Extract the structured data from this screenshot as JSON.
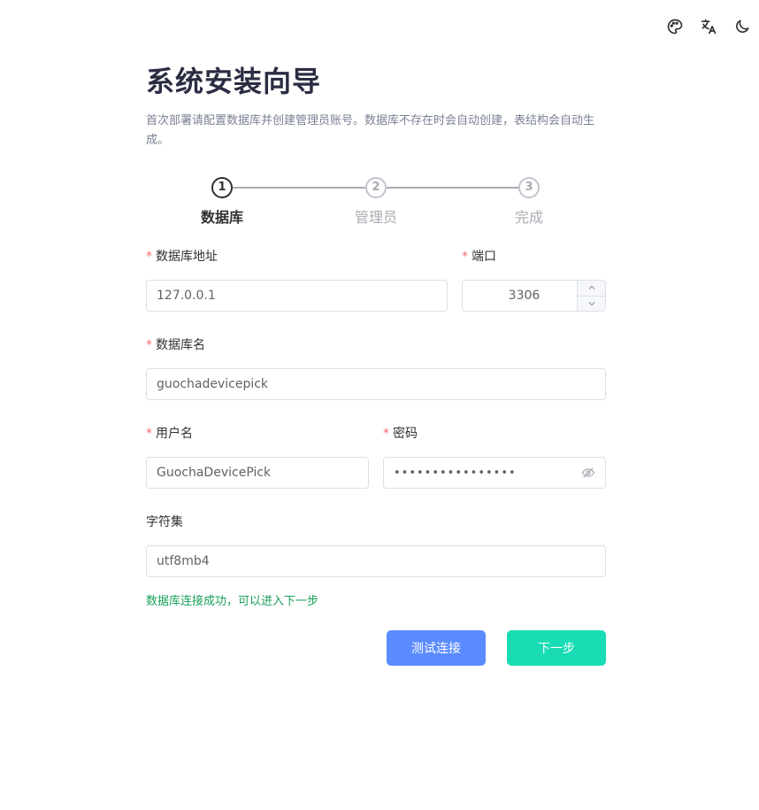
{
  "wizard": {
    "title": "系统安装向导",
    "description": "首次部署请配置数据库并创建管理员账号。数据库不存在时会自动创建，表结构会自动生成。"
  },
  "steps": [
    {
      "number": "1",
      "label": "数据库",
      "active": true
    },
    {
      "number": "2",
      "label": "管理员",
      "active": false
    },
    {
      "number": "3",
      "label": "完成",
      "active": false
    }
  ],
  "form": {
    "required_mark": "*",
    "host": {
      "label": "数据库地址",
      "value": "127.0.0.1"
    },
    "port": {
      "label": "端口",
      "value": "3306"
    },
    "db_name": {
      "label": "数据库名",
      "value": "guochadevicepick"
    },
    "username": {
      "label": "用户名",
      "value": "GuochaDevicePick"
    },
    "password": {
      "label": "密码",
      "value": "••••••••••••••••"
    },
    "charset": {
      "label": "字符集",
      "value": "utf8mb4"
    }
  },
  "status": {
    "message": "数据库连接成功，可以进入下一步",
    "color": "#18a058"
  },
  "buttons": {
    "test": "测试连接",
    "next": "下一步"
  },
  "toolbar": {
    "icons": [
      "palette-icon",
      "translate-icon",
      "moon-icon"
    ]
  },
  "colors": {
    "accent_blue": "#5b8cff",
    "accent_green": "#19dcb4",
    "required": "#f56c6c"
  }
}
